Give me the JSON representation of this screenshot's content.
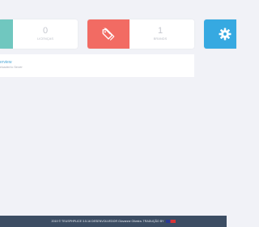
{
  "stats": [
    {
      "value": "0",
      "label": "LICENÇAS",
      "color": "#70c7bf",
      "icon": ""
    },
    {
      "value": "1",
      "label": "BRANDS",
      "color": "#f26b63",
      "icon": "tag-icon"
    },
    {
      "value": "",
      "label": "",
      "color": "#36a9e1",
      "icon": "gear-icon"
    }
  ],
  "overview": {
    "title": "erview",
    "subtitle": "eloaded to Server"
  },
  "footer": {
    "text": "2019 © TEUSPHPLICE 3.5.16 DESENVOLVEDOR Giovanne Oliveira. TRADUÇÃO BY"
  }
}
